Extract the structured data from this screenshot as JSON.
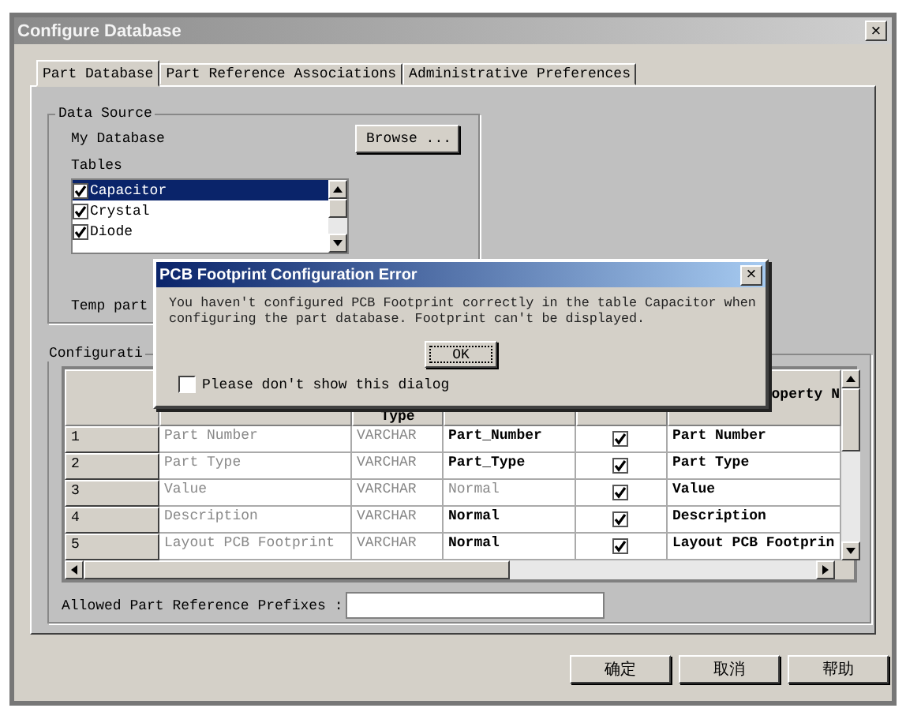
{
  "window": {
    "title": "Configure Database",
    "close": "×"
  },
  "tabs": [
    {
      "label": "Part Database",
      "selected": true
    },
    {
      "label": "Part Reference Associations",
      "selected": false
    },
    {
      "label": "Administrative Preferences",
      "selected": false
    }
  ],
  "data_source": {
    "title": "Data Source",
    "database_label": "My Database",
    "browse_button": "Browse ...",
    "tables_label": "Tables",
    "tables": [
      {
        "name": "Capacitor",
        "checked": true,
        "selected": true
      },
      {
        "name": "Crystal",
        "checked": true,
        "selected": false
      },
      {
        "name": "Diode",
        "checked": true,
        "selected": false
      }
    ],
    "temp_label": "Temp part"
  },
  "configuration": {
    "title": "Configurati",
    "type_header": "Type",
    "property_header": "operty N",
    "rows": [
      {
        "number": "1",
        "name": "Part Number",
        "type": "VARCHAR",
        "field": "Part_Number",
        "field_greyed": false,
        "checked": true,
        "property": "Part Number"
      },
      {
        "number": "2",
        "name": "Part Type",
        "type": "VARCHAR",
        "field": "Part_Type",
        "field_greyed": false,
        "checked": true,
        "property": "Part Type"
      },
      {
        "number": "3",
        "name": "Value",
        "type": "VARCHAR",
        "field": "Normal",
        "field_greyed": true,
        "checked": true,
        "property": "Value"
      },
      {
        "number": "4",
        "name": "Description",
        "type": "VARCHAR",
        "field": "Normal",
        "field_greyed": false,
        "checked": true,
        "property": "Description"
      },
      {
        "number": "5",
        "name": "Layout PCB Footprint",
        "type": "VARCHAR",
        "field": "Normal",
        "field_greyed": false,
        "checked": true,
        "property": "Layout PCB Footprin"
      }
    ],
    "prefixes_label": "Allowed Part Reference Prefixes :"
  },
  "buttons": [
    "确定",
    "取消",
    "帮助"
  ],
  "error_dialog": {
    "title": "PCB Footprint Configuration Error",
    "close": "×",
    "message": "You haven't configured PCB Footprint correctly in the table Capacitor when configuring the part database. Footprint can't be displayed.",
    "ok_button": "OK",
    "dont_show": {
      "label": "Please don't show this dialog",
      "checked": false
    }
  }
}
